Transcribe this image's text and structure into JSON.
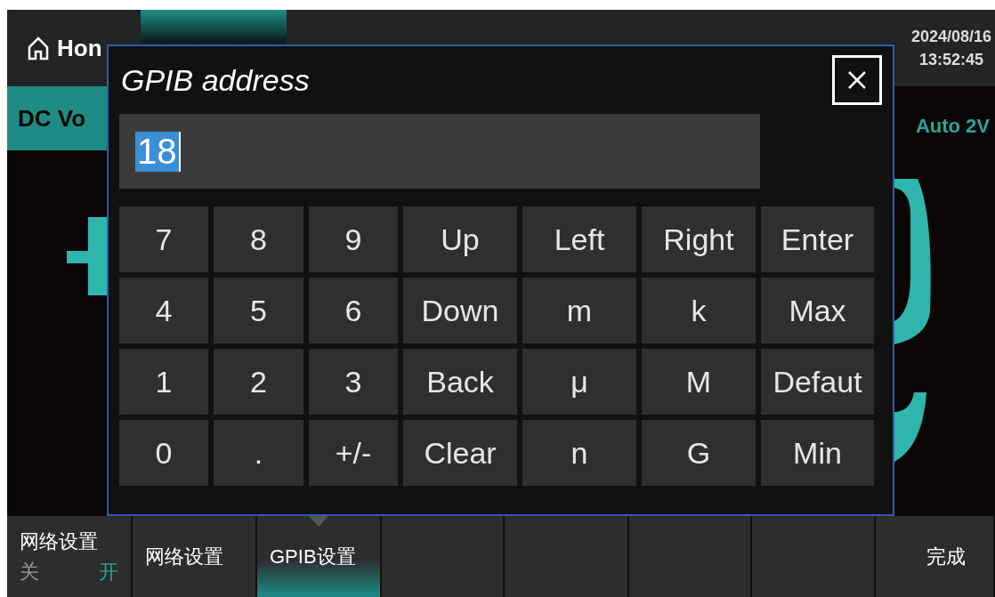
{
  "header": {
    "tabs": [
      {
        "label": "Hon",
        "selected": false
      },
      {
        "selected": true
      }
    ],
    "date": "2024/08/16",
    "time": "13:52:45"
  },
  "function_tab": {
    "label": "DC Vo"
  },
  "range": "Auto 2V",
  "dialog": {
    "title": "GPIB address",
    "value": "18",
    "keys": [
      [
        "7",
        "8",
        "9",
        "Up",
        "Left",
        "Right",
        "Enter"
      ],
      [
        "4",
        "5",
        "6",
        "Down",
        "m",
        "k",
        "Max"
      ],
      [
        "1",
        "2",
        "3",
        "Back",
        "μ",
        "M",
        "Defaut"
      ],
      [
        "0",
        ".",
        "+/-",
        "Clear",
        "n",
        "G",
        "Min"
      ]
    ]
  },
  "softkeys": [
    {
      "kind": "toggle",
      "label": "网络设置",
      "off": "关",
      "on": "开",
      "value": true,
      "selected": false
    },
    {
      "kind": "button",
      "label": "网络设置",
      "selected": false
    },
    {
      "kind": "button",
      "label": "GPIB设置",
      "selected": true
    },
    {
      "kind": "empty",
      "selected": false
    },
    {
      "kind": "empty",
      "selected": false
    },
    {
      "kind": "empty",
      "selected": false
    },
    {
      "kind": "empty",
      "selected": false
    },
    {
      "kind": "button",
      "label": "完成",
      "selected": false
    }
  ]
}
